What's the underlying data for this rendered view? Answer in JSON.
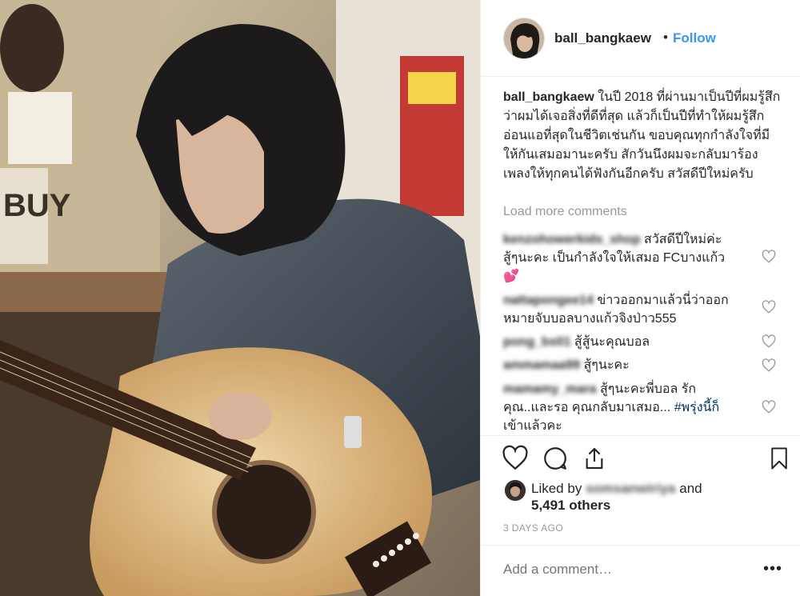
{
  "post": {
    "username": "ball_bangkaew",
    "follow_label": "Follow",
    "separator": "•",
    "caption_user": "ball_bangkaew",
    "caption_text": "ในปี 2018 ที่ผ่านมาเป็นปีที่ผมรู้สึกว่าผมได้เจอสิ่งที่ดีที่สุด แล้วก็เป็นปีที่ทำให้ผมรู้สึกอ่อนแอที่สุดในชีวิตเช่นกัน ขอบคุณทุกกำลังใจที่มีให้กันเสมอมานะครับ สักวันนึงผมจะกลับมาร้องเพลงให้ทุกคนได้ฟังกันอีกครับ สวัสดีปีใหม่ครับ",
    "load_more": "Load more comments"
  },
  "comments": [
    {
      "user": "kenzohowerkids_shop",
      "text_1": "สวัสดีปีใหม่ค่ะ",
      "text_2": "สู้ๆนะคะ เป็นกำลังใจให้เสมอ FCบางแก้ว",
      "text_3": "💕"
    },
    {
      "user": "nattapongee14",
      "text_1": "ข่าวออกมาแล้วนี่ว่าออก",
      "text_2": "หมายจับบอลบางแก้วจิงป่าว555"
    },
    {
      "user": "pong_bs01",
      "text_1": "สู้สู้นะคุณบอล"
    },
    {
      "user": "ammamaa99",
      "text_1": "สู้ๆนะคะ"
    },
    {
      "user": "mamamy_mara",
      "text_1": "สู้ๆนะคะพี่บอล รัก",
      "text_2": "คุณ..และรอ คุณกลับมาเสมอ...",
      "hashtag": "#พรุ่งนี้ก็",
      "text_3": "เข้าแล้วคะ"
    }
  ],
  "likes": {
    "liked_by_prefix": "Liked by",
    "liked_by_user": "somsanwiriya",
    "liked_by_suffix": "and",
    "others": "5,491 others"
  },
  "date": "3 DAYS AGO",
  "add_comment_placeholder": "Add a comment…",
  "more_label": "•••",
  "icons": [
    "heart-icon",
    "comment-icon",
    "share-icon",
    "bookmark-icon",
    "more-icon"
  ],
  "colors": {
    "follow": "#3897f0",
    "muted": "#999999",
    "hashtag": "#003569",
    "divider": "#efefef"
  }
}
